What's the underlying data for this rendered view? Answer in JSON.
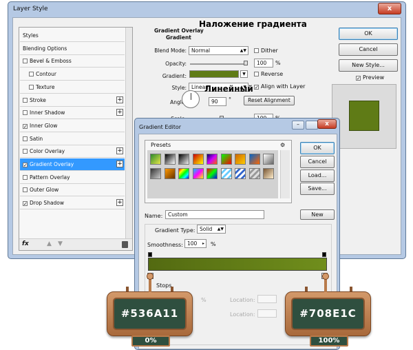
{
  "layer_style": {
    "title": "Layer Style",
    "close": "x",
    "list": [
      {
        "label": "Styles",
        "check": null,
        "plus": false,
        "sel": false,
        "indent": false
      },
      {
        "label": "Blending Options",
        "check": null,
        "plus": false,
        "sel": false,
        "indent": false
      },
      {
        "label": "Bevel & Emboss",
        "check": false,
        "plus": false,
        "sel": false,
        "indent": false
      },
      {
        "label": "Contour",
        "check": false,
        "plus": false,
        "sel": false,
        "indent": true
      },
      {
        "label": "Texture",
        "check": false,
        "plus": false,
        "sel": false,
        "indent": true
      },
      {
        "label": "Stroke",
        "check": false,
        "plus": true,
        "sel": false,
        "indent": false
      },
      {
        "label": "Inner Shadow",
        "check": false,
        "plus": true,
        "sel": false,
        "indent": false
      },
      {
        "label": "Inner Glow",
        "check": true,
        "plus": false,
        "sel": false,
        "indent": false
      },
      {
        "label": "Satin",
        "check": false,
        "plus": false,
        "sel": false,
        "indent": false
      },
      {
        "label": "Color Overlay",
        "check": false,
        "plus": true,
        "sel": false,
        "indent": false
      },
      {
        "label": "Gradient Overlay",
        "check": true,
        "plus": true,
        "sel": true,
        "indent": false
      },
      {
        "label": "Pattern Overlay",
        "check": false,
        "plus": false,
        "sel": false,
        "indent": false
      },
      {
        "label": "Outer Glow",
        "check": false,
        "plus": false,
        "sel": false,
        "indent": false
      },
      {
        "label": "Drop Shadow",
        "check": true,
        "plus": true,
        "sel": false,
        "indent": false
      }
    ],
    "fx_label": "fx",
    "section_title": "Gradient Overlay",
    "sub_title": "Gradient",
    "blend_mode_label": "Blend Mode:",
    "blend_mode_value": "Normal",
    "dither_label": "Dither",
    "opacity_label": "Opacity:",
    "opacity_value": "100",
    "percent": "%",
    "gradient_label": "Gradient:",
    "reverse_label": "Reverse",
    "style_label": "Style:",
    "style_value": "Linear",
    "align_label": "Align with Layer",
    "angle_label": "Angle:",
    "angle_value": "90",
    "degree": "°",
    "reset_label": "Reset Alignment",
    "scale_label": "Scale:",
    "scale_value": "100",
    "ok": "OK",
    "cancel": "Cancel",
    "new_style": "New Style...",
    "preview": "Preview",
    "gradient_color": "#5f7b16"
  },
  "overlay_text": {
    "gradient_ru": "Наложение градиента",
    "linear_ru": "Линейный"
  },
  "gradient_editor": {
    "title": "Gradient Editor",
    "minimize": "–",
    "close": "x",
    "presets_label": "Presets",
    "gear": "⚙",
    "ok": "OK",
    "cancel": "Cancel",
    "load": "Load...",
    "save": "Save...",
    "name_label": "Name:",
    "name_value": "Custom",
    "new_label": "New",
    "type_label": "Gradient Type:",
    "type_value": "Solid",
    "smooth_label": "Smoothness:",
    "smooth_value": "100",
    "percent": "%",
    "stops_label": "Stops",
    "location_label": "Location:",
    "start_color": "#536A11",
    "end_color": "#708E1C"
  },
  "callouts": {
    "left_hex": "#536A11",
    "left_pct": "0%",
    "right_hex": "#708E1C",
    "right_pct": "100%"
  }
}
